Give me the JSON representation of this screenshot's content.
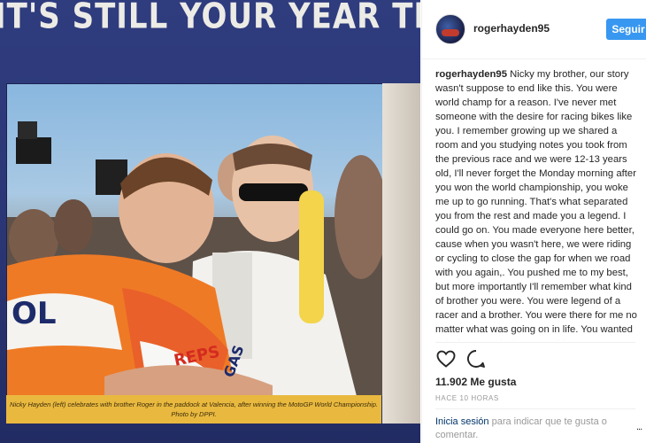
{
  "photo": {
    "headline": "IT'S STILL YOUR YEAR TRICK\"",
    "caption": "Nicky Hayden (left) celebrates with brother Roger in the paddock at Valencia, after winning the MotoGP World Championship. Photo by DPPI.",
    "jersey_text_1": "OL",
    "jersey_text_2": "REPS",
    "jersey_text_3": "GAS"
  },
  "post": {
    "username": "rogerhayden95",
    "follow_label": "Seguir",
    "comment_user": "rogerhayden95",
    "comment_text": "Nicky my brother, our story wasn't suppose to end like this. You were world champ for a reason. I've never met someone with the desire for racing bikes like you. I remember growing up we shared a room and you studying notes you took from the previous race and we were 12-13 years old, I'll never forget the Monday morning after you won the world championship, you woke me up to go running. That's what separated you from the rest and made you a legend. I could go on. You made everyone here better, cause when you wasn't here, we were riding or cycling to close the gap for when we road with you again,. You pushed me to my best, but more importantly I'll remember what kind of brother you were. You were legend of a racer and a brother. You were there for me no matter what was going on in life. You wanted to help. I'm so lucky we could",
    "likes": "11.902 Me gusta",
    "time": "HACE 10 HORAS",
    "login_link": "Inicia sesión",
    "login_rest": " para indicar que te gusta o comentar.",
    "more": "..."
  },
  "icons": [
    "heart-icon",
    "comment-icon"
  ],
  "colors": {
    "follow": "#3897f0",
    "link": "#003569",
    "muted": "#999999",
    "magazine_blue": "#2a3574",
    "caption_strip": "#e9b93f"
  }
}
